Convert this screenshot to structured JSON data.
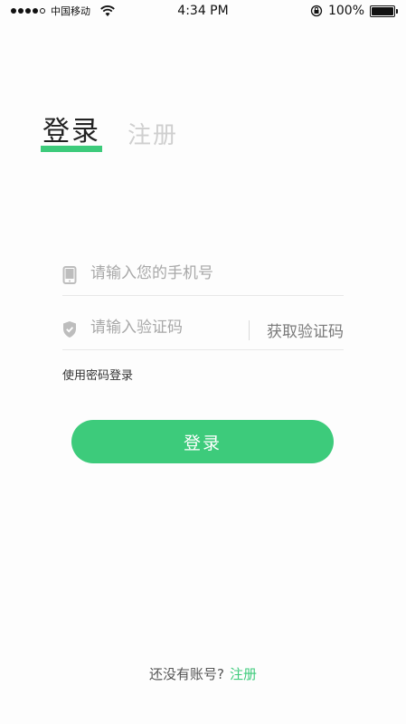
{
  "status_bar": {
    "carrier": "中国移动",
    "time": "4:34 PM",
    "battery": "100%",
    "battery_level": 1.0
  },
  "tabs": {
    "login": "登录",
    "register": "注册"
  },
  "phone_field": {
    "placeholder": "请输入您的手机号",
    "icon": "phone-icon"
  },
  "code_field": {
    "placeholder": "请输入验证码",
    "icon": "shield-icon",
    "get_code": "获取验证码"
  },
  "password_login": "使用密码登录",
  "login_button": "登录",
  "footer": {
    "prompt": "还没有账号?",
    "register_link": "注册"
  },
  "colors": {
    "accent": "#3dcb7b"
  }
}
